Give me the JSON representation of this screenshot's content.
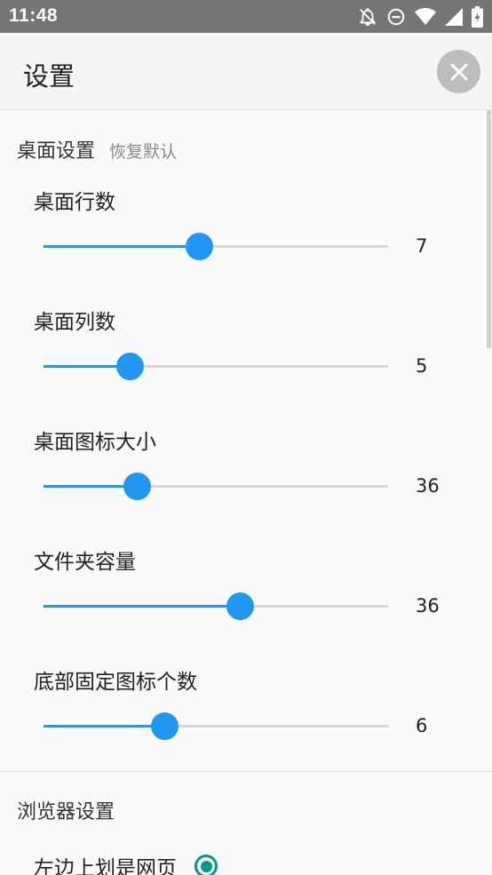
{
  "status_bar": {
    "time": "11:48",
    "icons": [
      "notifications-off-icon",
      "do-not-disturb-icon",
      "wifi-icon",
      "signal-icon",
      "battery-icon"
    ]
  },
  "app_bar": {
    "title": "设置",
    "close_icon": "close-icon"
  },
  "desktop_section": {
    "title": "桌面设置",
    "restore_default": "恢复默认",
    "settings": [
      {
        "label": "桌面行数",
        "value": "7",
        "fraction": 0.45
      },
      {
        "label": "桌面列数",
        "value": "5",
        "fraction": 0.25
      },
      {
        "label": "桌面图标大小",
        "value": "36",
        "fraction": 0.27
      },
      {
        "label": "文件夹容量",
        "value": "36",
        "fraction": 0.57
      },
      {
        "label": "底部固定图标个数",
        "value": "6",
        "fraction": 0.35
      }
    ]
  },
  "browser_section": {
    "title": "浏览器设置",
    "options": [
      {
        "label": "左边上划是网页",
        "selected": true
      }
    ]
  },
  "colors": {
    "accent": "#2196f3",
    "radio": "#009688",
    "status_bar": "#757575"
  }
}
